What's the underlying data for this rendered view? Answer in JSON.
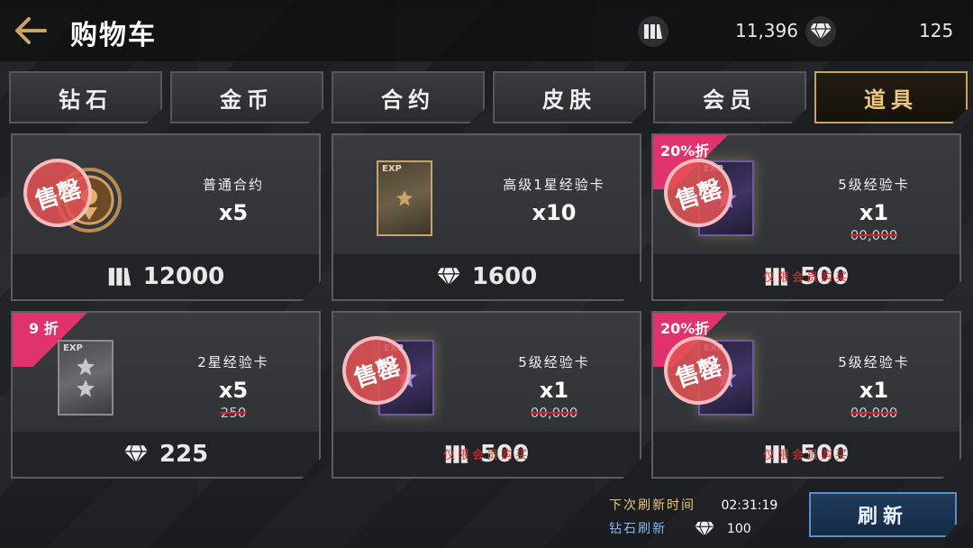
{
  "header": {
    "title": "购物车",
    "coins": "11,396",
    "diamonds": "125"
  },
  "tabs": [
    {
      "label": "钻石",
      "active": false
    },
    {
      "label": "金币",
      "active": false
    },
    {
      "label": "合约",
      "active": false
    },
    {
      "label": "皮肤",
      "active": false
    },
    {
      "label": "会员",
      "active": false
    },
    {
      "label": "道具",
      "active": true
    }
  ],
  "items": [
    {
      "name": "普通合约",
      "qty": "x5",
      "price": "12000",
      "currency": "coin-icon",
      "sold_out": true,
      "stamp": "售罄"
    },
    {
      "name": "高级1星经验卡",
      "qty": "x10",
      "price": "1600",
      "currency": "diamond-icon",
      "sold_out": false
    },
    {
      "name": "5级经验卡",
      "qty": "x1",
      "original_price": "00,000",
      "price": "500",
      "currency": "coin-icon",
      "discount": "20%折",
      "sold_out": true,
      "stamp": "售罄",
      "restriction": "仅限会员购买"
    },
    {
      "name": "2星经验卡",
      "qty": "x5",
      "original_price": "250",
      "price": "225",
      "currency": "diamond-icon",
      "discount": "9 折",
      "sold_out": false
    },
    {
      "name": "5级经验卡",
      "qty": "x1",
      "original_price": "00,000",
      "price": "500",
      "currency": "coin-icon",
      "sold_out": true,
      "stamp": "售罄",
      "restriction": "仅限会员购买"
    },
    {
      "name": "5级经验卡",
      "qty": "x1",
      "original_price": "00,000",
      "price": "500",
      "currency": "coin-icon",
      "discount": "20%折",
      "sold_out": true,
      "stamp": "售罄",
      "restriction": "仅限会员购买"
    }
  ],
  "footer": {
    "next_refresh_label": "下次刷新时间",
    "next_refresh_time": "02:31:19",
    "refresh_cost_label": "钻石刷新",
    "refresh_cost": "100",
    "refresh_button": "刷新"
  },
  "colors": {
    "accent_gold": "#c8a463",
    "discount_pink": "#e0336d",
    "sold_red": "#e45254",
    "refresh_blue": "#5b8fc8"
  }
}
